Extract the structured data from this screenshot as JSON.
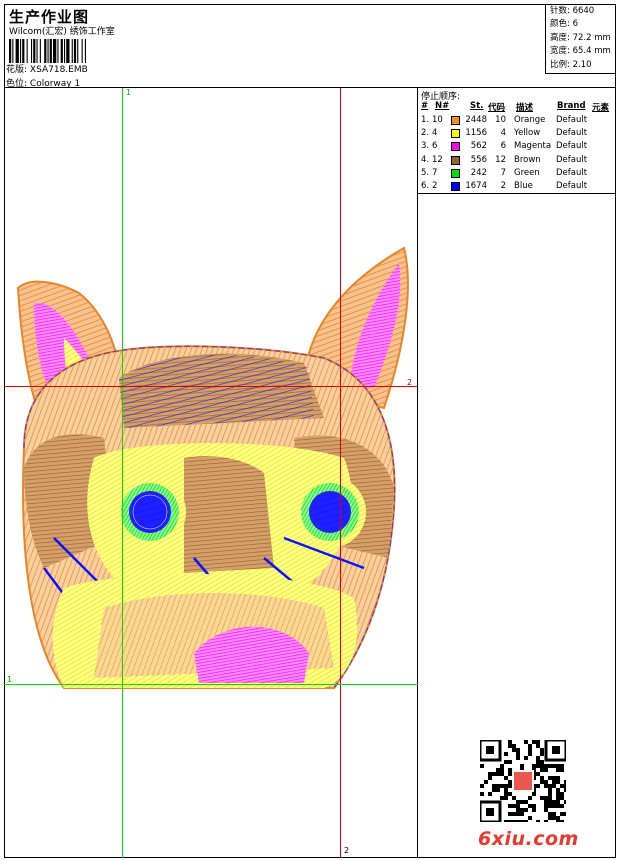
{
  "header": {
    "title": "生产作业图",
    "company": "Wilcom(汇宏) 绣饰工作室",
    "design_label": "花版:",
    "design_value": "XSA718.EMB",
    "color_label": "色位:",
    "color_value": "Colorway 1"
  },
  "meta": {
    "stitches_label": "针数:",
    "stitches_value": "6640",
    "colors_label": "颜色:",
    "colors_value": "6",
    "height_label": "高度:",
    "height_value": "72.2 mm",
    "width_label": "宽度:",
    "width_value": "65.4 mm",
    "scale_label": "比例:",
    "scale_value": "2.10"
  },
  "grid_labels": {
    "top_x": "1",
    "bottom_x": "2",
    "right_y": "2",
    "left_y": "1"
  },
  "stop_sequence": {
    "title": "停止顺序:",
    "headers": [
      "#",
      "N#",
      "St.",
      "代码",
      "描述",
      "Brand",
      "元素"
    ],
    "rows": [
      {
        "idx": "1.",
        "needle": "10",
        "stitches": "2448",
        "code": "10",
        "desc": "Orange",
        "brand": "Default",
        "color": "#f08c2c"
      },
      {
        "idx": "2.",
        "needle": "4",
        "stitches": "1156",
        "code": "4",
        "desc": "Yellow",
        "brand": "Default",
        "color": "#ffff00"
      },
      {
        "idx": "3.",
        "needle": "6",
        "stitches": "562",
        "code": "6",
        "desc": "Magenta",
        "brand": "Default",
        "color": "#ff00ff"
      },
      {
        "idx": "4.",
        "needle": "12",
        "stitches": "556",
        "code": "12",
        "desc": "Brown",
        "brand": "Default",
        "color": "#9a6431"
      },
      {
        "idx": "5.",
        "needle": "7",
        "stitches": "242",
        "code": "7",
        "desc": "Green",
        "brand": "Default",
        "color": "#00e000"
      },
      {
        "idx": "6.",
        "needle": "2",
        "stitches": "1674",
        "code": "2",
        "desc": "Blue",
        "brand": "Default",
        "color": "#0000ff"
      }
    ]
  },
  "watermark": {
    "text": "6xiu.com",
    "color": "#e8392f"
  },
  "colors": {
    "grid_green": "#00dd00",
    "grid_red": "#dd0000"
  }
}
